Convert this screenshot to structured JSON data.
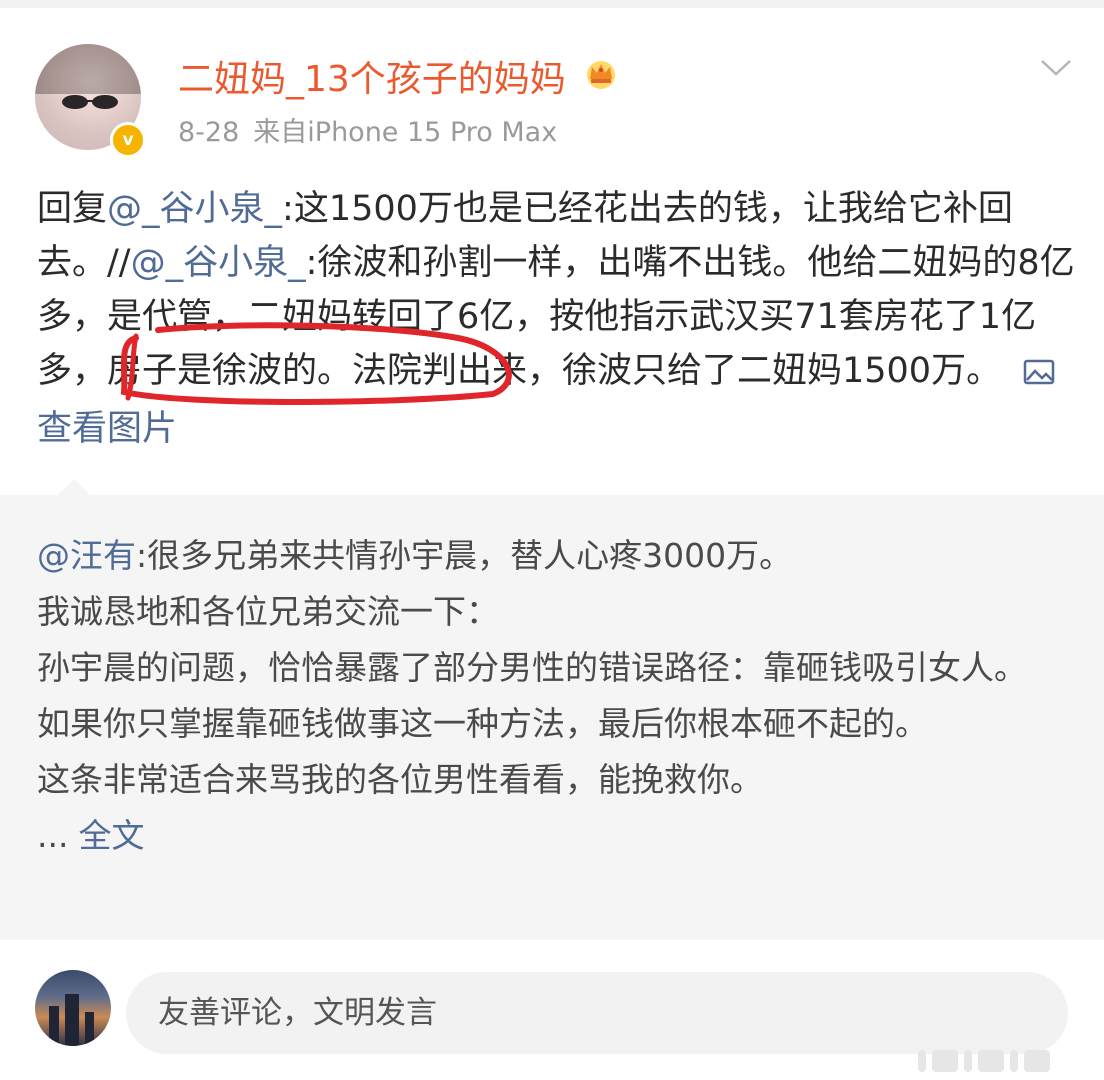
{
  "header": {
    "username": "二妞妈_13个孩子的妈妈",
    "date": "8-28",
    "source": "来自iPhone 15 Pro Max",
    "verified_mark": "v",
    "brand_color": "#ea5a2e"
  },
  "post": {
    "reply_prefix": "回复",
    "mention1": "@_谷小泉_",
    "text1": ":这1500万也是已经花出去的钱，让我给它补回去。//",
    "mention2": "@_谷小泉_",
    "text2": ":徐波和孙割一样，出嘴不出钱。他给二妞妈的8亿多，是代管，二妞妈转回了6亿，按他指示武汉买71套房花了1亿多，房子是徐波的。法院判出来，徐波只给了二妞妈1500万。",
    "view_images": "查看图片",
    "link_color": "#506b95",
    "annotation_color": "#e0262a"
  },
  "repost": {
    "mention": "@汪有",
    "text": ":很多兄弟来共情孙宇晨，替人心疼3000万。",
    "lines": [
      "我诚恳地和各位兄弟交流一下：",
      "孙宇晨的问题，恰恰暴露了部分男性的错误路径：靠砸钱吸引女人。",
      "如果你只掌握靠砸钱做事这一种方法，最后你根本砸不起的。",
      "这条非常适合来骂我的各位男性看看，能挽救你。"
    ],
    "ellipsis": "...",
    "full_text": "全文"
  },
  "comment_bar": {
    "placeholder": "友善评论，文明发言"
  },
  "icons": {
    "chevron": "chevron-down-icon",
    "crown": "crown-icon",
    "image": "image-icon"
  }
}
